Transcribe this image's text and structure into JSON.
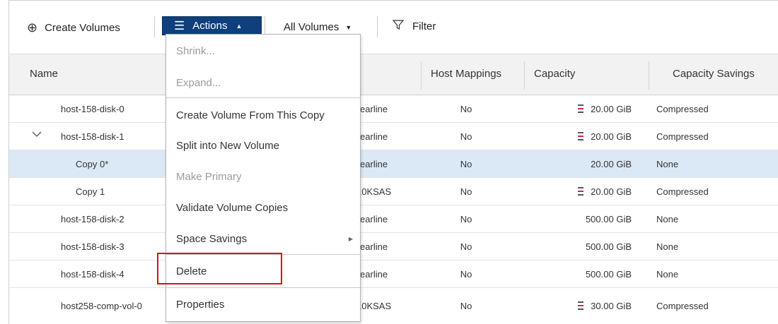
{
  "toolbar": {
    "create_label": "Create Volumes",
    "create_icon": "plus-circle-icon",
    "actions_label": "Actions",
    "actions_icon": "hamburger-icon",
    "all_volumes_label": "All Volumes",
    "filter_label": "Filter",
    "filter_icon": "funnel-icon",
    "actions_color": "#0f3f7c"
  },
  "table": {
    "headers": {
      "name": "Name",
      "pool": "ol",
      "host_mappings": "Host Mappings",
      "capacity": "Capacity",
      "capacity_savings": "Capacity Savings"
    },
    "rows": [
      {
        "name": "host-158-disk-0",
        "pool": ")-Nearline",
        "host": "No",
        "capacity": "20.00 GiB",
        "savings": "Compressed"
      },
      {
        "name": "host-158-disk-1",
        "pool": ")-Nearline",
        "host": "No",
        "capacity": "20.00 GiB",
        "savings": "Compressed"
      },
      {
        "name": "Copy 0*",
        "pool": ")-Nearline",
        "host": "No",
        "capacity": "20.00 GiB",
        "savings": "None"
      },
      {
        "name": "Copy 1",
        "pool": "P-10KSAS",
        "host": "No",
        "capacity": "20.00 GiB",
        "savings": "Compressed"
      },
      {
        "name": "host-158-disk-2",
        "pool": ")-Nearline",
        "host": "No",
        "capacity": "500.00 GiB",
        "savings": "None"
      },
      {
        "name": "host-158-disk-3",
        "pool": ")-Nearline",
        "host": "No",
        "capacity": "500.00 GiB",
        "savings": "None"
      },
      {
        "name": "host-158-disk-4",
        "pool": ")-Nearline",
        "host": "No",
        "capacity": "500.00 GiB",
        "savings": "None"
      },
      {
        "name": "host258-comp-vol-0",
        "pool": "P-10KSAS",
        "host": "No",
        "capacity": "30.00 GiB",
        "savings": "Compressed"
      }
    ]
  },
  "menu": {
    "items": [
      {
        "label": "Shrink...",
        "enabled": false
      },
      {
        "label": "Expand...",
        "enabled": false
      },
      {
        "label": "Create Volume From This Copy",
        "enabled": true
      },
      {
        "label": "Split into New Volume",
        "enabled": true
      },
      {
        "label": "Make Primary",
        "enabled": false
      },
      {
        "label": "Validate Volume Copies",
        "enabled": true
      },
      {
        "label": "Space Savings",
        "enabled": true
      },
      {
        "label": "Delete",
        "enabled": true
      },
      {
        "label": "Properties",
        "enabled": true
      }
    ],
    "highlight_color": "#e10c0c"
  }
}
